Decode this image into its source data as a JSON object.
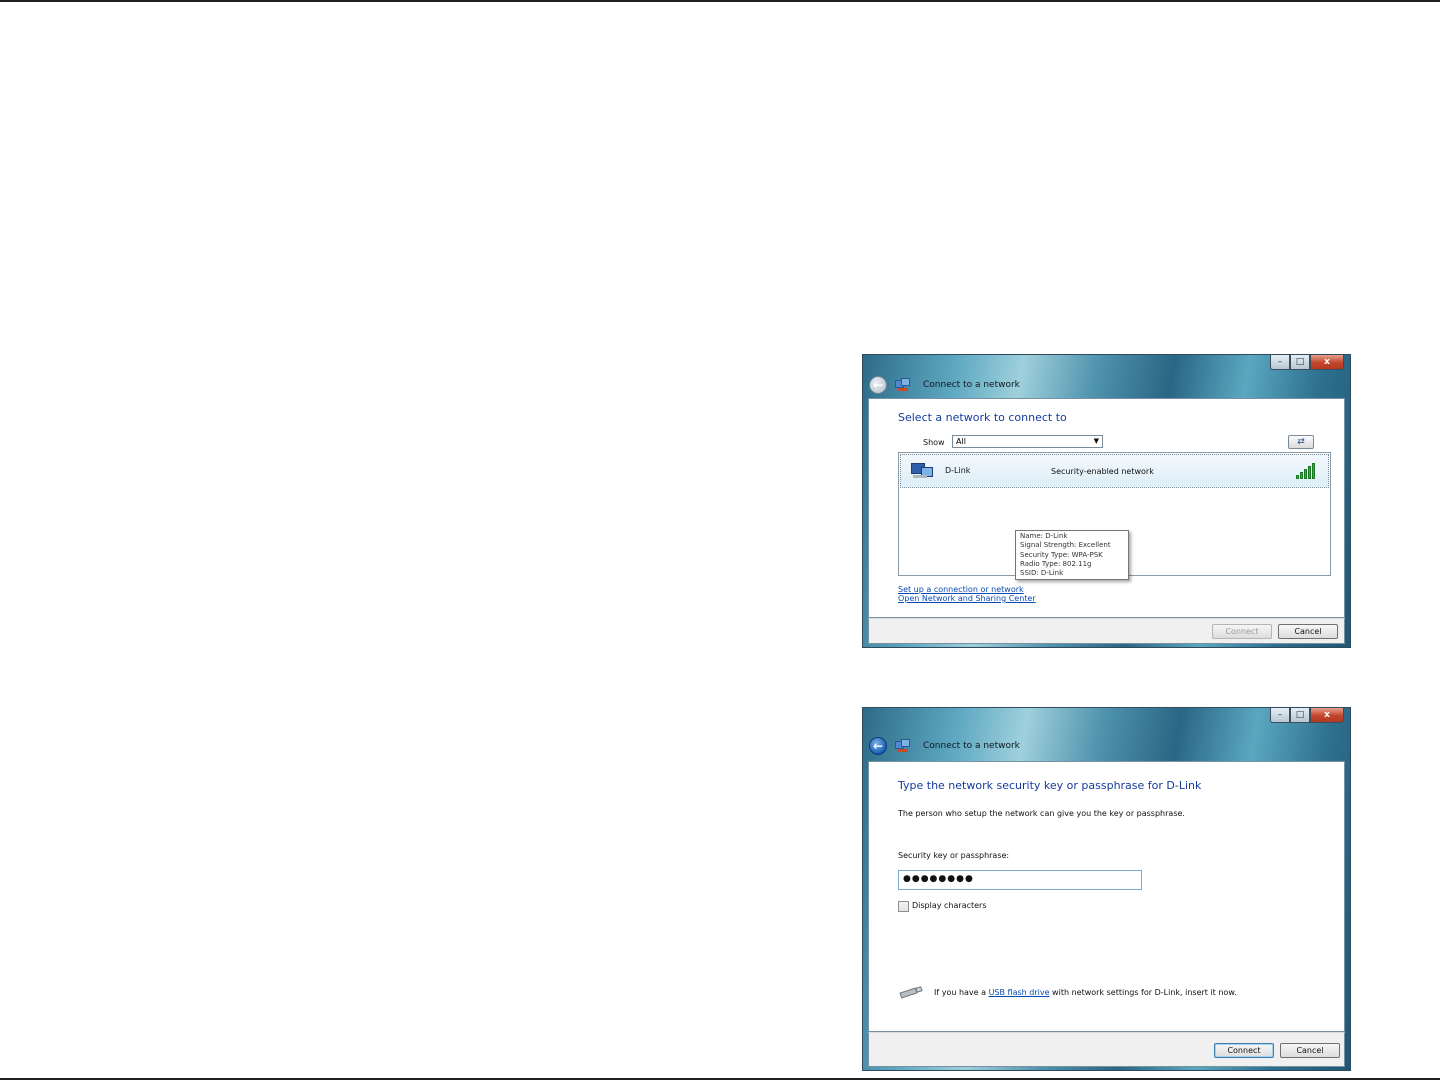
{
  "dialog1": {
    "title": "Connect to a network",
    "heading": "Select a network to connect to",
    "show_label": "Show",
    "show_value": "All",
    "network": {
      "name": "D-Link",
      "status": "Security-enabled network",
      "signal_bars_lit": 5
    },
    "tooltip": [
      "Name: D-Link",
      "Signal Strength: Excellent",
      "Security Type: WPA-PSK",
      "Radio Type: 802.11g",
      "SSID: D-Link"
    ],
    "links": {
      "setup": "Set up a connection or network",
      "sharing": "Open Network and Sharing Center"
    },
    "buttons": {
      "connect": "Connect",
      "cancel": "Cancel"
    }
  },
  "dialog2": {
    "title": "Connect to a network",
    "heading": "Type the network security key or passphrase for D-Link",
    "description": "The person who setup the network can give you the key or passphrase.",
    "key_label": "Security key or passphrase:",
    "key_value": "●●●●●●●●",
    "display_characters": "Display characters",
    "usb_prefix": "If you have a ",
    "usb_link": "USB flash drive",
    "usb_suffix": " with network settings for D-Link, insert it now.",
    "buttons": {
      "connect": "Connect",
      "cancel": "Cancel"
    }
  },
  "window_buttons": {
    "minimize": "–",
    "maximize": "□",
    "close": "x"
  },
  "icons": [
    "back-arrow-icon",
    "network-icon",
    "refresh-icon",
    "wireless-network-icon",
    "signal-strength-icon",
    "usb-drive-icon"
  ]
}
